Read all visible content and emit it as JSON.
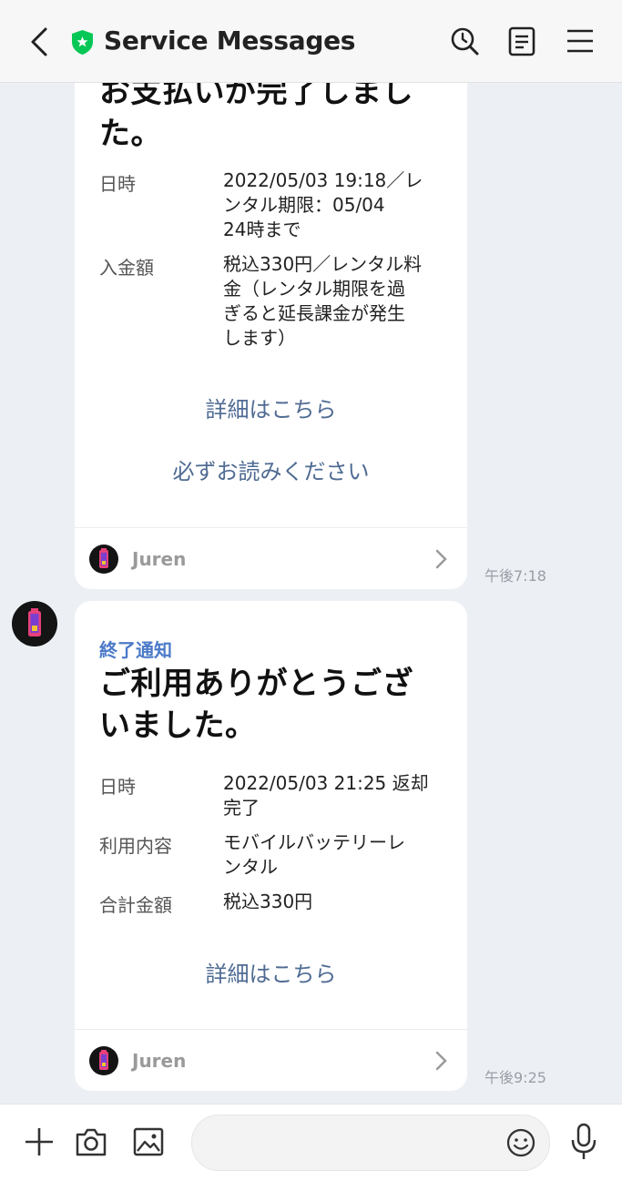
{
  "header": {
    "title": "Service Messages",
    "icons": [
      "back-chevron-icon",
      "verified-shield-icon",
      "search-history-icon",
      "notes-icon",
      "menu-icon"
    ],
    "shield_color": "#06c755"
  },
  "messages": [
    {
      "headline_lines": [
        "お支払いが完了しまし",
        "た。"
      ],
      "rows": [
        {
          "label": "日時",
          "value_lines": [
            "2022/05/03 19:18／レ",
            "ンタル期限：05/04",
            "24時まで"
          ]
        },
        {
          "label": "入金額",
          "value_lines": [
            "税込330円／レンタル料",
            "金（レンタル期限を過",
            "ぎると延長課金が発生",
            "します）"
          ]
        }
      ],
      "links": [
        "詳細はこちら",
        "必ずお読みください"
      ],
      "footer_name": "Juren",
      "time": "午後7:18"
    },
    {
      "category": "終了通知",
      "headline_lines": [
        "ご利用ありがとうござ",
        "いました。"
      ],
      "rows": [
        {
          "label": "日時",
          "value_lines": [
            "2022/05/03 21:25 返却",
            "完了"
          ]
        },
        {
          "label": "利用内容",
          "value_lines": [
            "モバイルバッテリーレ",
            "ンタル"
          ]
        },
        {
          "label": "合計金額",
          "value_lines": [
            "税込330円"
          ]
        }
      ],
      "links": [
        "詳細はこちら"
      ],
      "footer_name": "Juren",
      "time": "午後9:25"
    }
  ],
  "input_bar": {
    "icons": [
      "plus-icon",
      "camera-icon",
      "image-icon",
      "emoji-icon",
      "microphone-icon"
    ],
    "placeholder": ""
  },
  "colors": {
    "background": "#eceff4",
    "link": "#4f6b93",
    "category": "#4b7ac8"
  }
}
